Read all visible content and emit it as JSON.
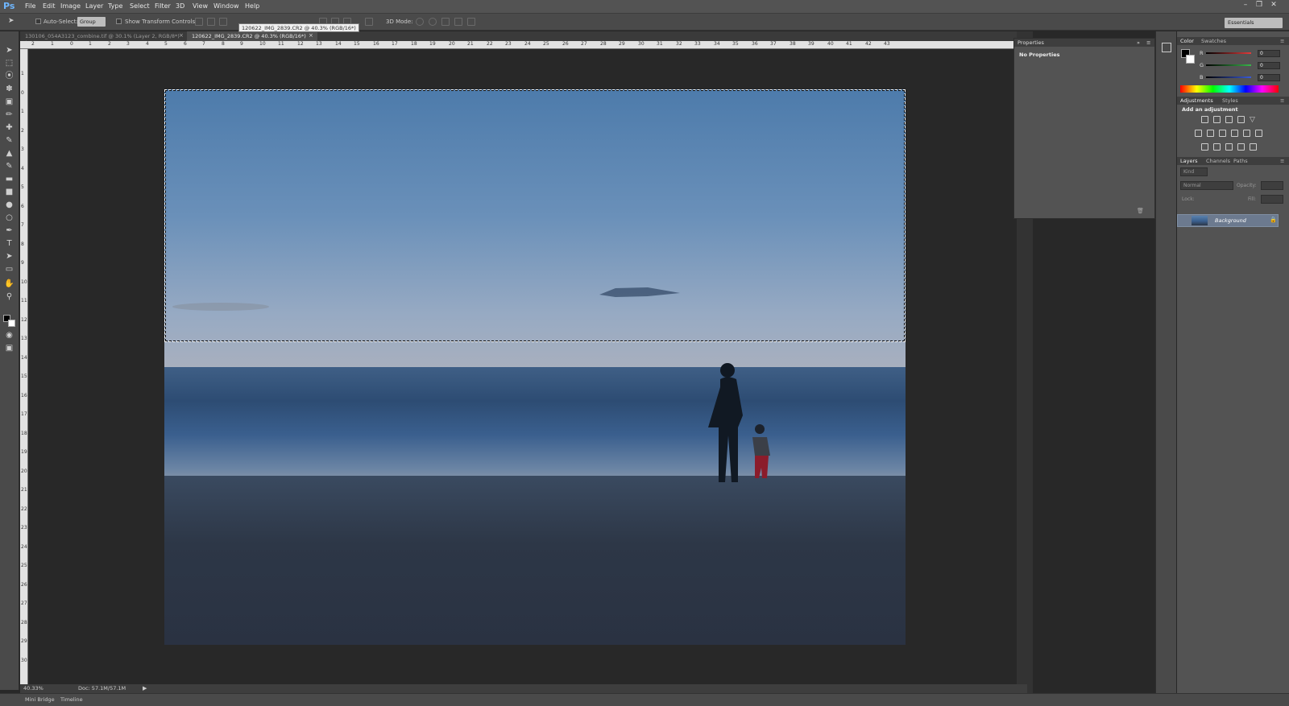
{
  "app": {
    "logo": "Ps"
  },
  "menu": [
    "File",
    "Edit",
    "Image",
    "Layer",
    "Type",
    "Select",
    "Filter",
    "3D",
    "View",
    "Window",
    "Help"
  ],
  "options_bar": {
    "auto_select_label": "Auto-Select:",
    "group_value": "Group",
    "transform_label": "Show Transform Controls",
    "mode_3d_label": "3D Mode:",
    "workspace": "Essentials"
  },
  "tabs": [
    {
      "label": "130106_054A3123_combine.tif @ 30.1% (Layer 2, RGB/8*) *"
    },
    {
      "label": "120622_IMG_2839.CR2 @ 40.3% (RGB/16*)"
    }
  ],
  "tooltip": "120622_IMG_2839.CR2 @ 40.3% (RGB/16*)",
  "ruler_h": [
    "2",
    "1",
    "0",
    "1",
    "2",
    "3",
    "4",
    "5",
    "6",
    "7",
    "8",
    "9",
    "10",
    "11",
    "12",
    "13",
    "14",
    "15",
    "16",
    "17",
    "18",
    "19",
    "20",
    "21",
    "22",
    "23",
    "24",
    "25",
    "26",
    "27",
    "28",
    "29",
    "30",
    "31",
    "32",
    "33",
    "34",
    "35",
    "36",
    "37",
    "38",
    "39",
    "40",
    "41",
    "42",
    "43"
  ],
  "ruler_v": [
    "1",
    "0",
    "1",
    "2",
    "3",
    "4",
    "5",
    "6",
    "7",
    "8",
    "9",
    "10",
    "11",
    "12",
    "13",
    "14",
    "15",
    "16",
    "17",
    "18",
    "19",
    "20",
    "21",
    "22",
    "23",
    "24",
    "25",
    "26",
    "27",
    "28",
    "29",
    "30",
    "31",
    "32",
    "33"
  ],
  "status": {
    "zoom": "40.33%",
    "doc": "Doc: 57.1M/57.1M"
  },
  "bottom_tabs": [
    "Mini Bridge",
    "Timeline"
  ],
  "properties": {
    "tab": "Properties",
    "content": "No Properties"
  },
  "color_panel": {
    "tabs": [
      "Color",
      "Swatches"
    ],
    "channels": [
      {
        "label": "R",
        "value": "0",
        "color": "#e23b3b"
      },
      {
        "label": "G",
        "value": "0",
        "color": "#39b54a"
      },
      {
        "label": "B",
        "value": "0",
        "color": "#3a5bd9"
      }
    ]
  },
  "adjustments": {
    "tabs": [
      "Adjustments",
      "Styles"
    ],
    "title": "Add an adjustment"
  },
  "layers": {
    "tabs": [
      "Layers",
      "Channels",
      "Paths"
    ],
    "kind": "Kind",
    "blend": "Normal",
    "opacity_label": "Opacity:",
    "lock_label": "Lock:",
    "fill_label": "Fill:",
    "layer_name": "Background"
  }
}
